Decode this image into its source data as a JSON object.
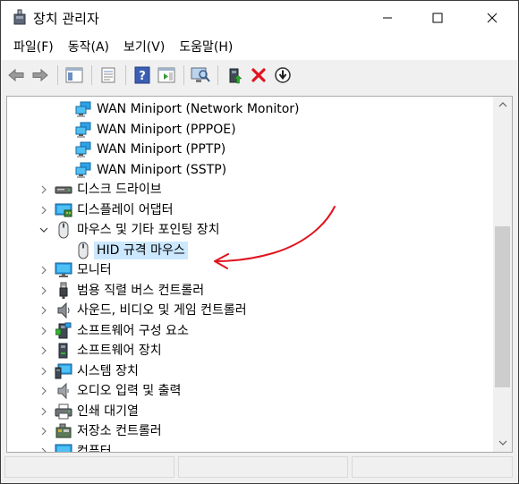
{
  "window": {
    "title": "장치 관리자"
  },
  "menu": [
    {
      "label": "파일(F)"
    },
    {
      "label": "동작(A)"
    },
    {
      "label": "보기(V)"
    },
    {
      "label": "도움말(H)"
    }
  ],
  "toolbar": {
    "icons": [
      "back-icon",
      "forward-icon",
      "show-hide-tree-icon",
      "properties-icon",
      "help-icon",
      "action-pane-icon",
      "scan-hardware-icon",
      "update-driver-icon",
      "uninstall-icon",
      "disable-icon"
    ]
  },
  "tree": {
    "items": [
      {
        "label": "WAN Miniport (Network Monitor)",
        "icon": "network-adapter-icon",
        "level": 2,
        "expander": ""
      },
      {
        "label": "WAN Miniport (PPPOE)",
        "icon": "network-adapter-icon",
        "level": 2,
        "expander": ""
      },
      {
        "label": "WAN Miniport (PPTP)",
        "icon": "network-adapter-icon",
        "level": 2,
        "expander": ""
      },
      {
        "label": "WAN Miniport (SSTP)",
        "icon": "network-adapter-icon",
        "level": 2,
        "expander": ""
      },
      {
        "label": "디스크 드라이브",
        "icon": "disk-drive-icon",
        "level": 1,
        "expander": "collapsed"
      },
      {
        "label": "디스플레이 어댑터",
        "icon": "display-adapter-icon",
        "level": 1,
        "expander": "collapsed"
      },
      {
        "label": "마우스 및 기타 포인팅 장치",
        "icon": "mouse-icon",
        "level": 1,
        "expander": "expanded"
      },
      {
        "label": "HID 규격 마우스",
        "icon": "mouse-icon",
        "level": 2,
        "expander": "",
        "selected": true
      },
      {
        "label": "모니터",
        "icon": "monitor-icon",
        "level": 1,
        "expander": "collapsed"
      },
      {
        "label": "범용 직렬 버스 컨트롤러",
        "icon": "usb-icon",
        "level": 1,
        "expander": "collapsed"
      },
      {
        "label": "사운드, 비디오 및 게임 컨트롤러",
        "icon": "speaker-icon",
        "level": 1,
        "expander": "collapsed"
      },
      {
        "label": "소프트웨어 구성 요소",
        "icon": "software-component-icon",
        "level": 1,
        "expander": "collapsed"
      },
      {
        "label": "소프트웨어 장치",
        "icon": "software-device-icon",
        "level": 1,
        "expander": "collapsed"
      },
      {
        "label": "시스템 장치",
        "icon": "system-device-icon",
        "level": 1,
        "expander": "collapsed"
      },
      {
        "label": "오디오 입력 및 출력",
        "icon": "audio-io-icon",
        "level": 1,
        "expander": "collapsed"
      },
      {
        "label": "인쇄 대기열",
        "icon": "printer-icon",
        "level": 1,
        "expander": "collapsed"
      },
      {
        "label": "저장소 컨트롤러",
        "icon": "storage-controller-icon",
        "level": 1,
        "expander": "collapsed"
      },
      {
        "label": "컴퓨터",
        "icon": "computer-icon",
        "level": 1,
        "expander": "collapsed"
      }
    ]
  },
  "colors": {
    "selection": "#cce8ff",
    "annotation": "#e0141e",
    "network": "#2aa3e8",
    "remove": "#e0141e"
  }
}
